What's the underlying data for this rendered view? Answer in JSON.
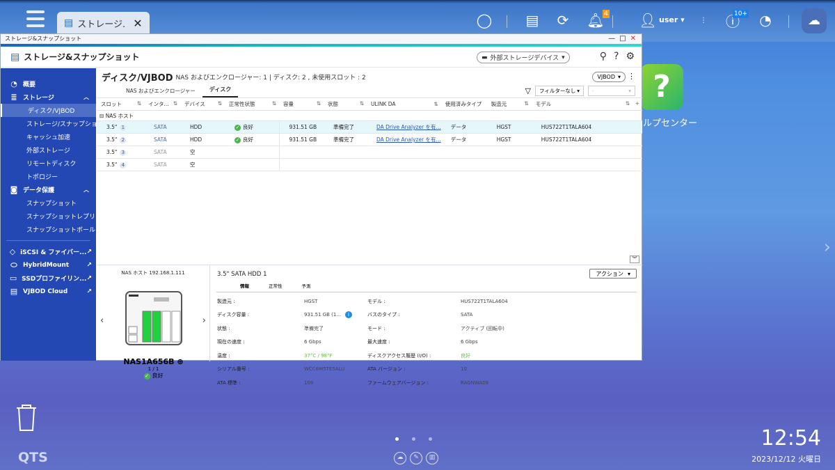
{
  "taskbar": {
    "app_tab_label": "ストレージ...",
    "user": "user",
    "notification_count": "4",
    "update_count": "10+"
  },
  "window": {
    "title": "ストレージ&スナップショット",
    "app_title": "ストレージ&スナップショット",
    "ext_storage_label": "外部ストレージデバイス"
  },
  "sidebar": {
    "overview": "概要",
    "storage": "ストレージ",
    "storage_items": [
      "ディスク/VJBOD",
      "ストレージ/スナップショ...",
      "キャッシュ加速",
      "外部ストレージ",
      "リモートディスク",
      "トポロジー"
    ],
    "data_protection": "データ保護",
    "protection_items": [
      "スナップショット",
      "スナップショットレプリカ",
      "スナップショットボールト"
    ],
    "ext_items": [
      "iSCSI & ファイバー...",
      "HybridMount",
      "SSDプロファイリン...",
      "VJBOD Cloud"
    ]
  },
  "main": {
    "title": "ディスク/VJBOD",
    "summary": "NAS およびエンクロージャー: 1 | ディスク: 2 , 未使用スロット : 2",
    "vjbod_label": "VJBOD",
    "tabs": [
      "NAS およびエンクロージャー",
      "ディスク"
    ],
    "filter_label": "フィルターなし",
    "filter2": "-",
    "columns": [
      "スロット",
      "インタ...",
      "デバイス",
      "正常性状態",
      "容量",
      "状態",
      "ULINK DA",
      "使用済みタイプ",
      "製造元",
      "モデル"
    ],
    "group": "NAS ホスト",
    "rows": [
      {
        "slot": "3.5\"",
        "num": "1",
        "iface": "SATA",
        "device": "HDD",
        "health": "良好",
        "capacity": "931.51 GB",
        "status": "準備完了",
        "ulink": "DA Drive Analyzer を有...",
        "type": "データ",
        "vendor": "HGST",
        "model": "HUS722T1TALA604"
      },
      {
        "slot": "3.5\"",
        "num": "2",
        "iface": "SATA",
        "device": "HDD",
        "health": "良好",
        "capacity": "931.51 GB",
        "status": "準備完了",
        "ulink": "DA Drive Analyzer を有...",
        "type": "データ",
        "vendor": "HGST",
        "model": "HUS722T1TALA604"
      },
      {
        "slot": "3.5\"",
        "num": "3",
        "iface": "SATA",
        "device": "空"
      },
      {
        "slot": "3.5\"",
        "num": "4",
        "iface": "SATA",
        "device": "空"
      }
    ]
  },
  "device": {
    "host": "NAS ホスト 192.168.1.111",
    "name": "NAS1A656B",
    "page": "1 / 1",
    "status": "良好"
  },
  "detail": {
    "title": "3.5\" SATA HDD 1",
    "action": "アクション",
    "tabs": [
      "情報",
      "正常性",
      "予測"
    ],
    "rows": [
      {
        "k1": "製造元 :",
        "v1": "HGST",
        "k2": "モデル :",
        "v2": "HUS722T1TALA604"
      },
      {
        "k1": "ディスク容量 :",
        "v1": "931.51 GB (1...",
        "k2": "バスのタイプ :",
        "v2": "SATA"
      },
      {
        "k1": "状態 :",
        "v1": "準備完了",
        "k2": "モード :",
        "v2": "アクティブ (回転中)"
      },
      {
        "k1": "現在の速度 :",
        "v1": "6 Gbps",
        "k2": "最大速度 :",
        "v2": "6 Gbps"
      },
      {
        "k1": "温度 :",
        "v1": "37°C / 98°F",
        "k2": "ディスクアクセス履歴 (I/O) :",
        "v2": "良好"
      },
      {
        "k1": "シリアル番号 :",
        "v1": "WCC6M5TE5ALU",
        "k2": "ATA バージョン :",
        "v2": "10"
      },
      {
        "k1": "ATA 標準 :",
        "v1": "109",
        "k2": "ファームウェアバージョン :",
        "v2": "RAGNWA09"
      }
    ]
  },
  "desktop": {
    "help_label": "ルプセンター",
    "qts": "QTS",
    "time": "12:54",
    "date": "2023/12/12 火曜日"
  }
}
